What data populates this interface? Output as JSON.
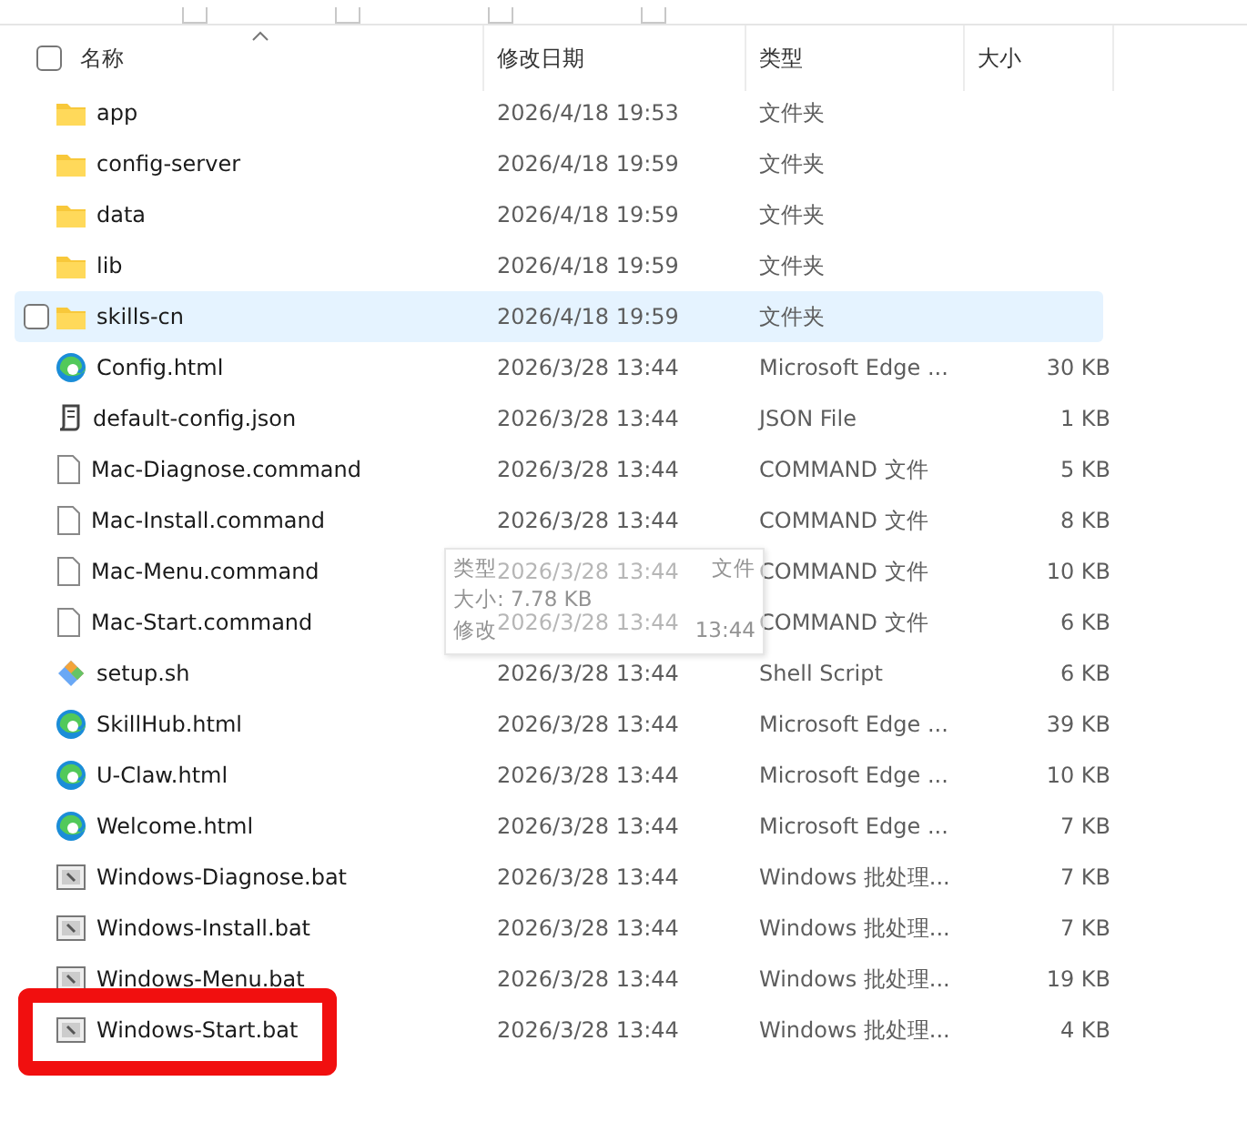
{
  "header": {
    "select_all": {
      "checked": false
    },
    "columns": [
      {
        "label": "名称",
        "sorted": true
      },
      {
        "label": "修改日期",
        "sorted": false
      },
      {
        "label": "类型",
        "sorted": false
      },
      {
        "label": "大小",
        "sorted": false
      }
    ]
  },
  "rows": [
    {
      "kind": "folder",
      "name": "app",
      "date": "2026/4/18 19:53",
      "type": "文件夹",
      "size": "",
      "selected": false,
      "highlighted": false
    },
    {
      "kind": "folder",
      "name": "config-server",
      "date": "2026/4/18 19:59",
      "type": "文件夹",
      "size": "",
      "selected": false,
      "highlighted": false
    },
    {
      "kind": "folder",
      "name": "data",
      "date": "2026/4/18 19:59",
      "type": "文件夹",
      "size": "",
      "selected": false,
      "highlighted": false
    },
    {
      "kind": "folder",
      "name": "lib",
      "date": "2026/4/18 19:59",
      "type": "文件夹",
      "size": "",
      "selected": false,
      "highlighted": false
    },
    {
      "kind": "folder",
      "name": "skills-cn",
      "date": "2026/4/18 19:59",
      "type": "文件夹",
      "size": "",
      "selected": true,
      "highlighted": false
    },
    {
      "kind": "edge",
      "name": "Config.html",
      "date": "2026/3/28 13:44",
      "type": "Microsoft Edge ...",
      "size": "30 KB",
      "selected": false,
      "highlighted": false
    },
    {
      "kind": "json",
      "name": "default-config.json",
      "date": "2026/3/28 13:44",
      "type": "JSON File",
      "size": "1 KB",
      "selected": false,
      "highlighted": false
    },
    {
      "kind": "file",
      "name": "Mac-Diagnose.command",
      "date": "2026/3/28 13:44",
      "type": "COMMAND 文件",
      "size": "5 KB",
      "selected": false,
      "highlighted": false
    },
    {
      "kind": "file",
      "name": "Mac-Install.command",
      "date": "2026/3/28 13:44",
      "type": "COMMAND 文件",
      "size": "8 KB",
      "selected": false,
      "highlighted": false
    },
    {
      "kind": "file",
      "name": "Mac-Menu.command",
      "date": "2026/3/28 13:44",
      "type": "COMMAND 文件",
      "size": "10 KB",
      "selected": false,
      "highlighted": false
    },
    {
      "kind": "file",
      "name": "Mac-Start.command",
      "date": "2026/3/28 13:44",
      "type": "COMMAND 文件",
      "size": "6 KB",
      "selected": false,
      "highlighted": false
    },
    {
      "kind": "script",
      "name": "setup.sh",
      "date": "2026/3/28 13:44",
      "type": "Shell Script",
      "size": "6 KB",
      "selected": false,
      "highlighted": false
    },
    {
      "kind": "edge",
      "name": "SkillHub.html",
      "date": "2026/3/28 13:44",
      "type": "Microsoft Edge ...",
      "size": "39 KB",
      "selected": false,
      "highlighted": false
    },
    {
      "kind": "edge",
      "name": "U-Claw.html",
      "date": "2026/3/28 13:44",
      "type": "Microsoft Edge ...",
      "size": "10 KB",
      "selected": false,
      "highlighted": false
    },
    {
      "kind": "edge",
      "name": "Welcome.html",
      "date": "2026/3/28 13:44",
      "type": "Microsoft Edge ...",
      "size": "7 KB",
      "selected": false,
      "highlighted": false
    },
    {
      "kind": "bat",
      "name": "Windows-Diagnose.bat",
      "date": "2026/3/28 13:44",
      "type": "Windows 批处理...",
      "size": "7 KB",
      "selected": false,
      "highlighted": false
    },
    {
      "kind": "bat",
      "name": "Windows-Install.bat",
      "date": "2026/3/28 13:44",
      "type": "Windows 批处理...",
      "size": "7 KB",
      "selected": false,
      "highlighted": false
    },
    {
      "kind": "bat",
      "name": "Windows-Menu.bat",
      "date": "2026/3/28 13:44",
      "type": "Windows 批处理...",
      "size": "19 KB",
      "selected": false,
      "highlighted": false
    },
    {
      "kind": "bat",
      "name": "Windows-Start.bat",
      "date": "2026/3/28 13:44",
      "type": "Windows 批处理...",
      "size": "4 KB",
      "selected": false,
      "highlighted": true
    }
  ],
  "tooltip": {
    "lines": [
      [
        "类型",
        "文件"
      ],
      [
        "大小: 7.78 KB"
      ],
      [
        "修改",
        "13:44"
      ]
    ]
  }
}
